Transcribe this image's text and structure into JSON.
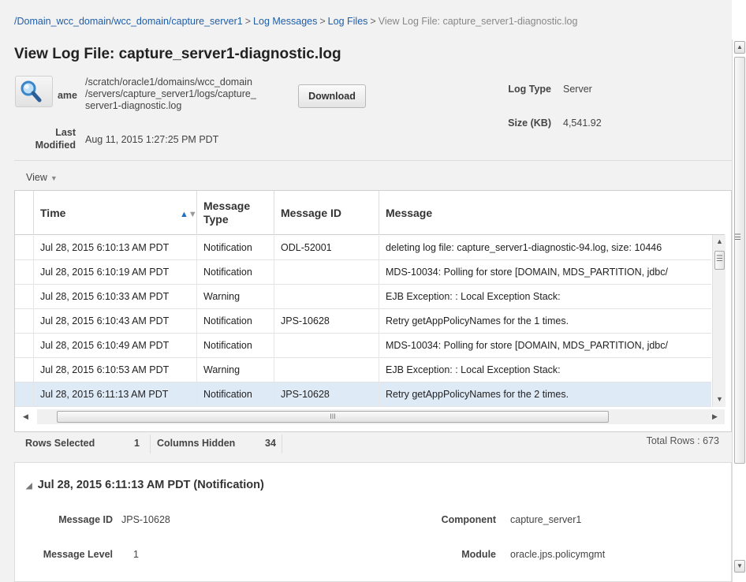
{
  "breadcrumb": {
    "items": [
      "/Domain_wcc_domain/wcc_domain/capture_server1",
      "Log Messages",
      "Log Files"
    ],
    "separator": ">",
    "current": "View Log File: capture_server1-diagnostic.log"
  },
  "page_title": "View Log File: capture_server1-diagnostic.log",
  "file_info": {
    "name_label": "ame",
    "name_value_line1": "/scratch/oracle1/domains/wcc_domain",
    "name_value_line2": "/servers/capture_server1/logs/capture_",
    "name_value_line3": "server1-diagnostic.log",
    "download_label": "Download",
    "last_modified_label_1": "Last",
    "last_modified_label_2": "Modified",
    "last_modified_value": "Aug 11, 2015 1:27:25 PM PDT",
    "log_type_label": "Log Type",
    "log_type_value": "Server",
    "size_label": "Size (KB)",
    "size_value": "4,541.92"
  },
  "view_menu": {
    "label": "View",
    "arrow": "▼"
  },
  "table": {
    "columns": [
      {
        "label": "Time"
      },
      {
        "label": "Message Type"
      },
      {
        "label": "Message ID"
      },
      {
        "label": "Message"
      }
    ],
    "rows": [
      {
        "time": "Jul 28, 2015 6:10:13 AM PDT",
        "type": "Notification",
        "id": "ODL-52001",
        "message": "deleting log file: capture_server1-diagnostic-94.log, size: 10446"
      },
      {
        "time": "Jul 28, 2015 6:10:19 AM PDT",
        "type": "Notification",
        "id": "",
        "message": "MDS-10034: Polling for store [DOMAIN, MDS_PARTITION, jdbc/"
      },
      {
        "time": "Jul 28, 2015 6:10:33 AM PDT",
        "type": "Warning",
        "id": "",
        "message": "EJB Exception: : Local Exception Stack:"
      },
      {
        "time": "Jul 28, 2015 6:10:43 AM PDT",
        "type": "Notification",
        "id": "JPS-10628",
        "message": "Retry getAppPolicyNames for the 1 times."
      },
      {
        "time": "Jul 28, 2015 6:10:49 AM PDT",
        "type": "Notification",
        "id": "",
        "message": "MDS-10034: Polling for store [DOMAIN, MDS_PARTITION, jdbc/"
      },
      {
        "time": "Jul 28, 2015 6:10:53 AM PDT",
        "type": "Warning",
        "id": "",
        "message": "EJB Exception: : Local Exception Stack:"
      },
      {
        "time": "Jul 28, 2015 6:11:13 AM PDT",
        "type": "Notification",
        "id": "JPS-10628",
        "message": "Retry getAppPolicyNames for the 2 times."
      }
    ],
    "selected_row_index": 6,
    "scroll_grip": "III"
  },
  "status": {
    "rows_selected_label": "Rows Selected",
    "rows_selected_value": "1",
    "columns_hidden_label": "Columns Hidden",
    "columns_hidden_value": "34",
    "total_rows": "Total Rows : 673"
  },
  "detail": {
    "title": "Jul 28, 2015 6:11:13 AM PDT (Notification)",
    "message_id_label": "Message ID",
    "message_id_value": "JPS-10628",
    "message_level_label": "Message Level",
    "message_level_value": "1",
    "component_label": "Component",
    "component_value": "capture_server1",
    "module_label": "Module",
    "module_value": "oracle.jps.policymgmt"
  },
  "colors": {
    "link": "#1f5ea8",
    "selected_row": "#dfeaf7",
    "sort_active": "#1f6fc2"
  }
}
